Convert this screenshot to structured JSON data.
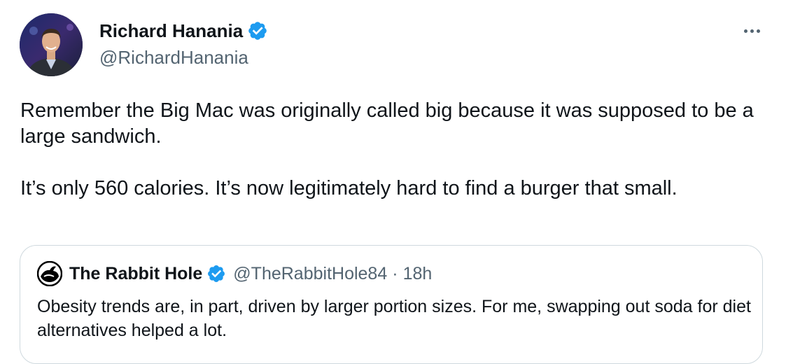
{
  "author": {
    "name": "Richard Hanania",
    "handle": "@RichardHanania",
    "verified": true
  },
  "tweet": {
    "paragraphs": [
      "Remember the Big Mac was originally called big because it was supposed to be a large sandwich.",
      "It’s only 560 calories. It’s now legitimately hard to find a burger that small."
    ]
  },
  "quoted_tweet": {
    "name": "The Rabbit Hole",
    "handle": "@TheRabbitHole84",
    "separator": "·",
    "time": "18h",
    "verified": true,
    "text": "Obesity trends are, in part, driven by larger portion sizes. For me, swapping out soda for diet alternatives helped a lot."
  },
  "icons": {
    "avatar": "profile-photo",
    "verified": "verified-badge-icon",
    "more": "more-options-icon",
    "quote_avatar": "rabbit-hole-logo"
  },
  "colors": {
    "verified_blue": "#1d9bf0",
    "secondary_text": "#536471",
    "primary_text": "#0f1419",
    "border": "#cfd9de"
  }
}
